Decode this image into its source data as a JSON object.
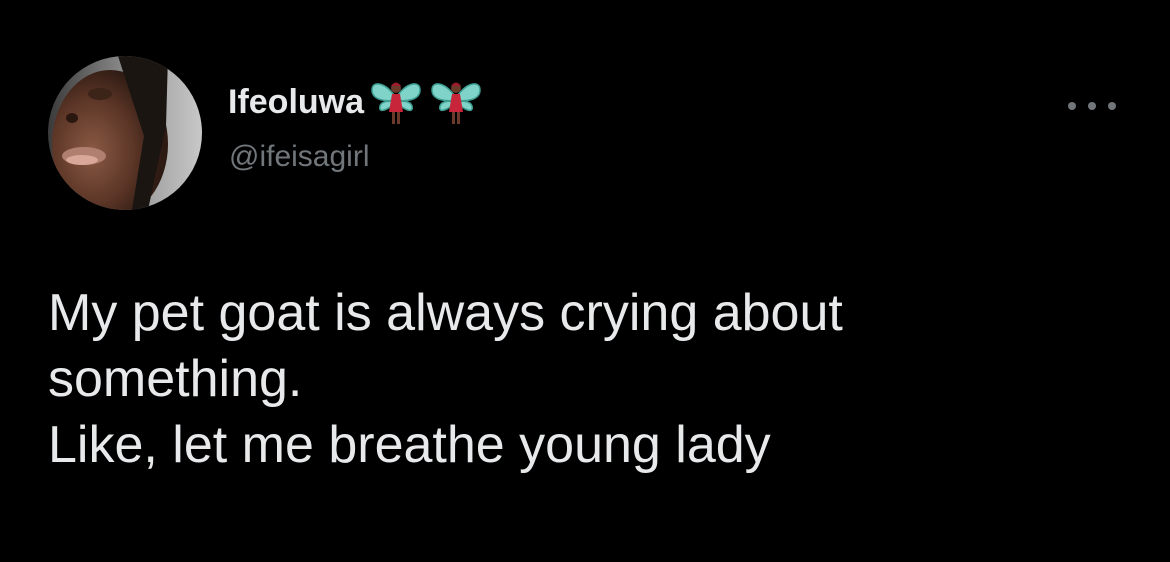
{
  "user": {
    "display_name": "Ifeoluwa",
    "name_emoji": [
      "fairy-emoji",
      "fairy-emoji"
    ],
    "handle": "@ifeisagirl",
    "avatar": "avatar-photo"
  },
  "menu": {
    "icon": "more-horizontal-icon"
  },
  "tweet": {
    "lines": [
      "My pet goat is always crying about",
      "something.",
      "Like, let me breathe young lady"
    ]
  },
  "colors": {
    "background": "#000000",
    "text_primary": "#e7e9ea",
    "text_secondary": "#71767b"
  }
}
